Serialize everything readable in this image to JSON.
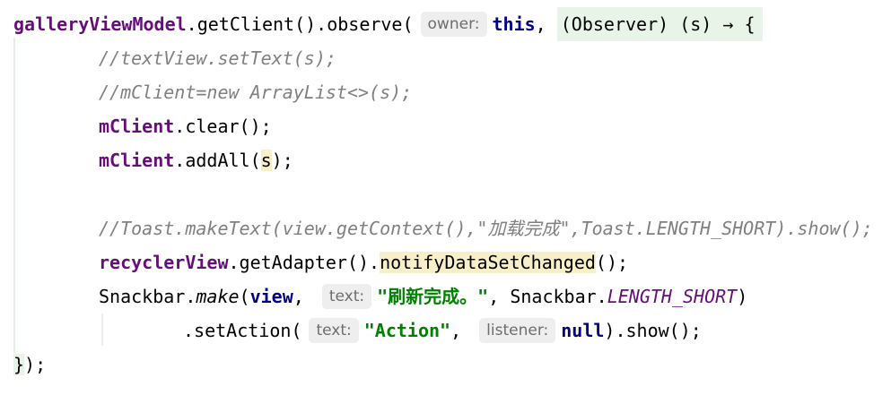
{
  "code": {
    "line1": {
      "receiver": "galleryViewModel",
      "call": ".getClient().observe(",
      "hint": "owner:",
      "this_kw": "this",
      "comma": ",",
      "lambda": "(Observer) (s) → {"
    },
    "line2": {
      "comment": "//textView.setText(s);"
    },
    "line3": {
      "comment": "//mClient=new ArrayList<>(s);"
    },
    "line4": {
      "field": "mClient",
      "call": ".clear();"
    },
    "line5": {
      "field": "mClient",
      "call": ".addAll(",
      "arg": "s",
      "end": ");"
    },
    "line6": {
      "comment": "//Toast.makeText(view.getContext(),\"加载完成\",Toast.LENGTH_SHORT).show();"
    },
    "line7": {
      "field": "recyclerView",
      "call1": ".getAdapter().",
      "method": "notifyDataSetChanged",
      "end": "();"
    },
    "line8": {
      "class": "Snackbar",
      "dot": ".",
      "method": "make",
      "open": "(",
      "arg": "view",
      "comma": ",",
      "hint": "text:",
      "string": "\"刷新完成。\"",
      "comma2": ", ",
      "class2": "Snackbar.",
      "constant": "LENGTH_SHORT",
      "close": ")"
    },
    "line9": {
      "call": ".setAction(",
      "hint1": "text:",
      "string": "\"Action\"",
      "comma": ",",
      "hint2": "listener:",
      "null_kw": "null",
      "end": ").show();"
    },
    "line10": {
      "close_brace": "}",
      "end": ");"
    }
  },
  "colors": {
    "field": "#660e7a",
    "keyword": "#000080",
    "comment": "#808080",
    "string": "#008000",
    "hint_bg": "#eeeeee",
    "lambda_bg": "#e8f4e8",
    "ref_bg": "#f6efc8"
  }
}
